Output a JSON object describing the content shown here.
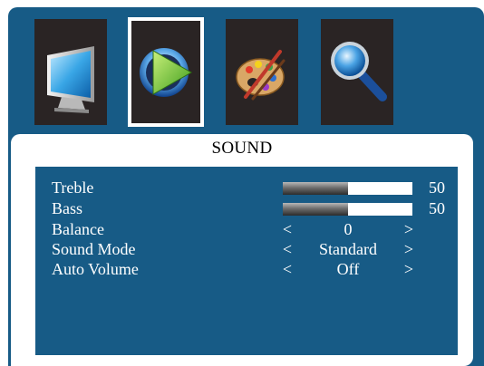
{
  "menu": {
    "icons": [
      {
        "name": "picture-icon",
        "selected": false
      },
      {
        "name": "sound-icon",
        "selected": true
      },
      {
        "name": "setup-icon",
        "selected": false
      },
      {
        "name": "search-icon",
        "selected": false
      }
    ]
  },
  "panel": {
    "title": "SOUND"
  },
  "settings": {
    "treble": {
      "label": "Treble",
      "value": "50",
      "level": 0.5
    },
    "bass": {
      "label": "Bass",
      "value": "50",
      "level": 0.5
    },
    "balance": {
      "label": "Balance",
      "value": "0"
    },
    "sound_mode": {
      "label": "Sound Mode",
      "value": "Standard"
    },
    "auto_volume": {
      "label": "Auto Volume",
      "value": "Off"
    },
    "arrow_left": "<",
    "arrow_right": ">"
  },
  "colors": {
    "osd_background": "#175b86",
    "tile_background": "#2a2424",
    "text": "#ffffff"
  }
}
